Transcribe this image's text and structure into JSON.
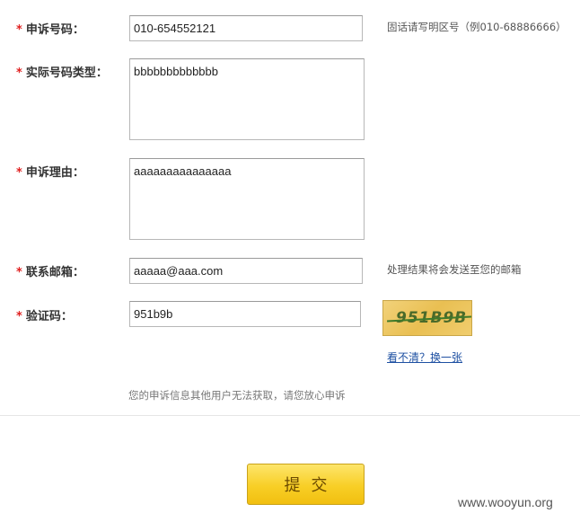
{
  "form": {
    "required_mark": "*",
    "phone": {
      "label": "申诉号码：",
      "value": "010-654552121",
      "hint": "固话请写明区号（例010-68886666）"
    },
    "actual_type": {
      "label": "实际号码类型：",
      "value": "bbbbbbbbbbbbb"
    },
    "reason": {
      "label": "申诉理由：",
      "value": "aaaaaaaaaaaaaaa"
    },
    "email": {
      "label": "联系邮箱：",
      "value": "aaaaa@aaa.com",
      "hint": "处理结果将会发送至您的邮箱"
    },
    "captcha": {
      "label": "验证码：",
      "value": "951b9b",
      "image_text": "951B9B",
      "refresh_link": "看不清？换一张"
    },
    "privacy_note": "您的申诉信息其他用户无法获取，请您放心申诉",
    "submit_label": "提交"
  },
  "watermark": "www.wooyun.org",
  "colors": {
    "required": "#e02020",
    "link": "#1e50a2",
    "submit_button": "#f8cf26"
  }
}
